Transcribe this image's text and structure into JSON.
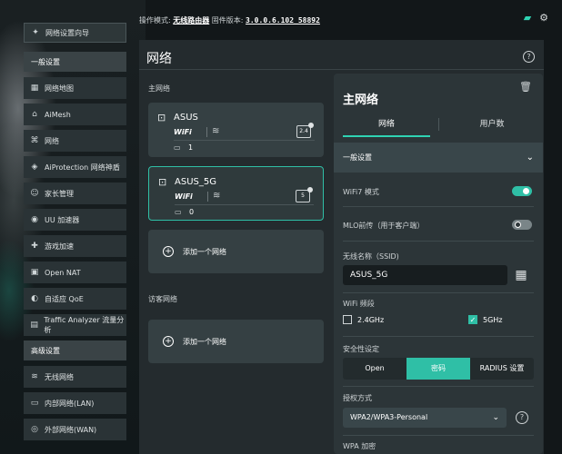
{
  "topbar": {
    "mode_label": "操作模式:",
    "mode_value": "无线路由器",
    "firmware_label": "固件版本:",
    "firmware_value": "3.0.0.6.102_58892"
  },
  "sidebar": {
    "wizard": "网络设置向导",
    "general_section": "一般设置",
    "general_items": [
      "网络地图",
      "AiMesh",
      "网络",
      "AiProtection 网络神盾",
      "家长管理",
      "UU 加速器",
      "游戏加速",
      "Open NAT",
      "自适应 QoE",
      "Traffic Analyzer 流量分析"
    ],
    "advanced_section": "高级设置",
    "advanced_items": [
      "无线网络",
      "内部网络(LAN)",
      "外部网络(WAN)"
    ]
  },
  "main": {
    "title": "网络",
    "primary_label": "主网络",
    "networks": [
      {
        "name": "ASUS",
        "wifi": "WiFi",
        "band": "2.4",
        "devices": "1"
      },
      {
        "name": "ASUS_5G",
        "wifi": "WiFi",
        "band": "5",
        "devices": "0"
      }
    ],
    "add_network": "添加一个网络",
    "guest_label": "访客网络",
    "guest_add": "添加一个网络"
  },
  "detail": {
    "title": "主网络",
    "tabs": [
      "网络",
      "用户数"
    ],
    "group": "一般设置",
    "wifi7_label": "WiFi7 模式",
    "mlo_label": "MLO前传（用于客户端）",
    "ssid_label": "无线名称（SSID)",
    "ssid_value": "ASUS_5G",
    "band_label": "WiFi 频段",
    "band_24": "2.4GHz",
    "band_5": "5GHz",
    "security_label": "安全性设定",
    "security_options": [
      "Open",
      "密码",
      "RADIUS 设置"
    ],
    "auth_label": "授权方式",
    "auth_value": "WPA2/WPA3-Personal",
    "wpa_label": "WPA 加密"
  },
  "colors": {
    "accent": "#2fbfa6",
    "panel": "#2c3538",
    "background": "#121719"
  }
}
